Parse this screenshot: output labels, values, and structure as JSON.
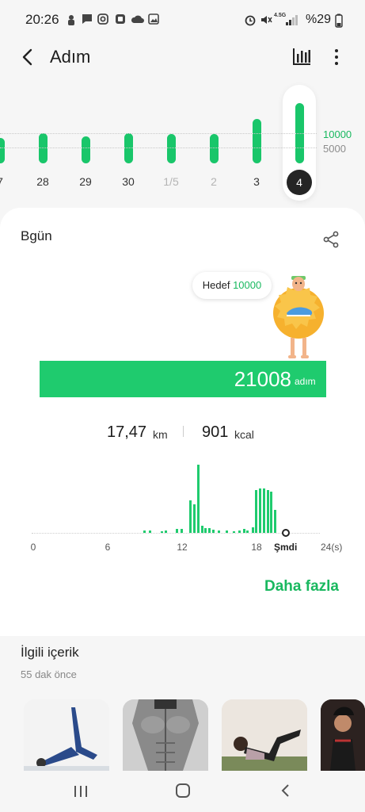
{
  "status_bar": {
    "time": "20:26",
    "battery": "%29",
    "network": "4.5G"
  },
  "header": {
    "title": "Adım"
  },
  "week": {
    "days": [
      {
        "label": "7",
        "dim": false,
        "steps_fraction": 0.4
      },
      {
        "label": "28",
        "dim": false,
        "steps_fraction": 0.48
      },
      {
        "label": "29",
        "dim": false,
        "steps_fraction": 0.42
      },
      {
        "label": "30",
        "dim": false,
        "steps_fraction": 0.48
      },
      {
        "label": "1/5",
        "dim": true,
        "steps_fraction": 0.46
      },
      {
        "label": "2",
        "dim": true,
        "steps_fraction": 0.46
      },
      {
        "label": "3",
        "dim": false,
        "steps_fraction": 0.7
      },
      {
        "label": "4",
        "dim": false,
        "selected": true,
        "steps_fraction": 0.95
      }
    ],
    "goal_high": "10000",
    "goal_low": "5000",
    "accent": "#19c66a"
  },
  "today": {
    "label": "Bgün",
    "goal_prefix": "Hedef",
    "goal_value": "10000",
    "steps": "21008",
    "steps_unit": "adım",
    "distance": "17,47",
    "distance_unit": "km",
    "calories": "901",
    "calories_unit": "kcal"
  },
  "hourly": {
    "ticks": [
      "0",
      "6",
      "12",
      "18"
    ],
    "now_label": "Şmdi",
    "end_label": "24(s)",
    "values": [
      [
        8.9,
        0.03
      ],
      [
        9.3,
        0.03
      ],
      [
        10.3,
        0.02
      ],
      [
        10.6,
        0.03
      ],
      [
        11.5,
        0.05
      ],
      [
        11.9,
        0.05
      ],
      [
        12.6,
        0.45
      ],
      [
        12.9,
        0.4
      ],
      [
        13.2,
        0.96
      ],
      [
        13.5,
        0.1
      ],
      [
        13.8,
        0.07
      ],
      [
        14.1,
        0.07
      ],
      [
        14.4,
        0.04
      ],
      [
        14.9,
        0.03
      ],
      [
        15.5,
        0.03
      ],
      [
        16.1,
        0.02
      ],
      [
        16.5,
        0.03
      ],
      [
        16.9,
        0.05
      ],
      [
        17.2,
        0.03
      ],
      [
        17.6,
        0.08
      ],
      [
        17.9,
        0.6
      ],
      [
        18.2,
        0.62
      ],
      [
        18.5,
        0.62
      ],
      [
        18.8,
        0.6
      ],
      [
        19.1,
        0.58
      ],
      [
        19.4,
        0.32
      ]
    ],
    "max_hour": 24,
    "now_hour": 20.5
  },
  "more_label": "Daha fazla",
  "related": {
    "title": "İlgili içerik",
    "time": "55 dak önce"
  }
}
